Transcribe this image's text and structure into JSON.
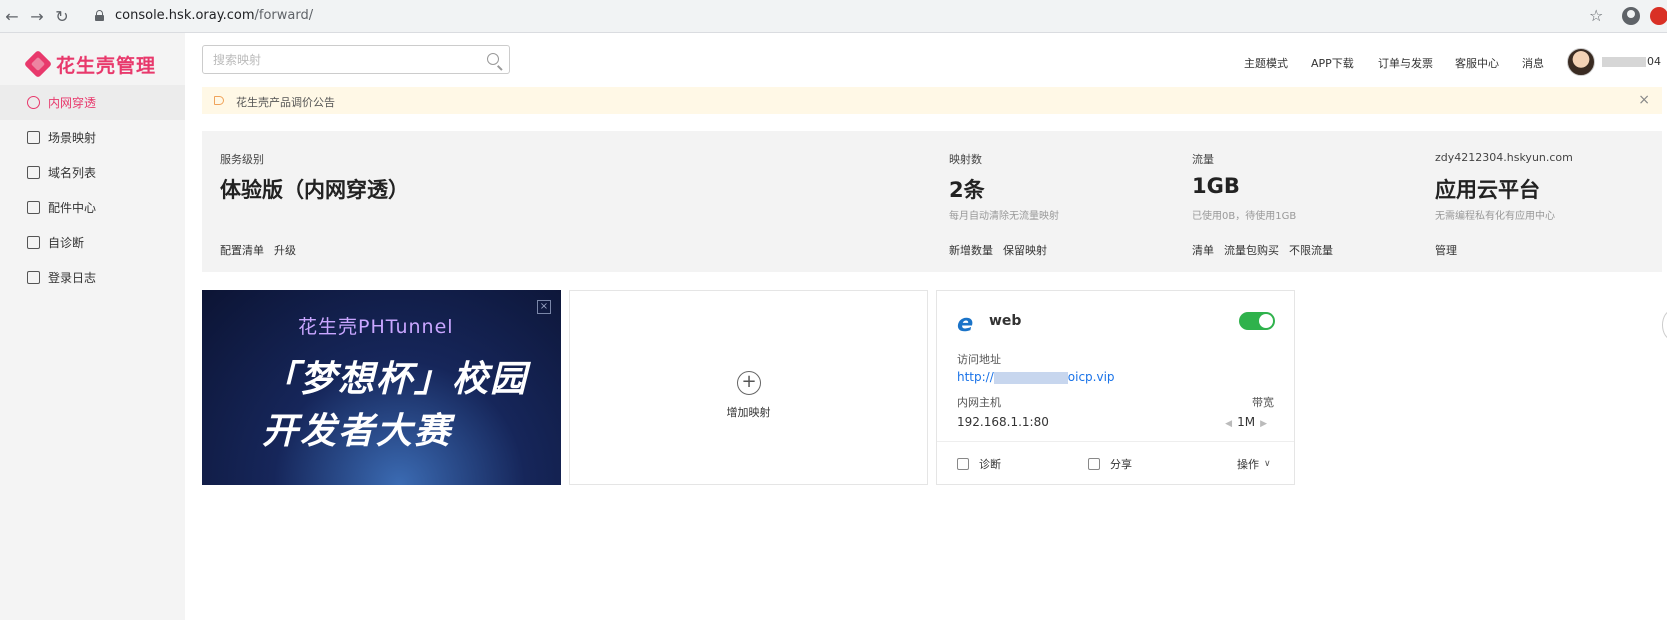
{
  "browser": {
    "url_host": "console.hsk.oray.com",
    "url_path": "/forward/"
  },
  "brand": {
    "name": "花生壳管理"
  },
  "sidebar": {
    "items": [
      {
        "label": "内网穿透",
        "icon": "network-icon",
        "active": true
      },
      {
        "label": "场景映射",
        "icon": "scene-icon",
        "active": false
      },
      {
        "label": "域名列表",
        "icon": "domain-icon",
        "active": false
      },
      {
        "label": "配件中心",
        "icon": "grid-icon",
        "active": false
      },
      {
        "label": "自诊断",
        "icon": "stethoscope-icon",
        "active": false
      },
      {
        "label": "登录日志",
        "icon": "log-icon",
        "active": false
      }
    ]
  },
  "header": {
    "search_placeholder": "搜索映射",
    "nav": [
      "主题模式",
      "APP下载",
      "订单与发票",
      "客服中心",
      "消息"
    ],
    "username_suffix": "04"
  },
  "notice": {
    "text": "花生壳产品调价公告"
  },
  "summary": {
    "service": {
      "label": "服务级别",
      "value": "体验版（内网穿透）",
      "links": [
        "配置清单",
        "升级"
      ]
    },
    "mappings": {
      "label": "映射数",
      "value": "2条",
      "sub": "每月自动清除无流量映射",
      "links": [
        "新增数量",
        "保留映射"
      ]
    },
    "traffic": {
      "label": "流量",
      "value": "1GB",
      "sub": "已使用0B，待使用1GB",
      "links": [
        "清单",
        "流量包购买",
        "不限流量"
      ]
    },
    "cloud": {
      "label": "zdy4212304.hskyun.com",
      "value": "应用云平台",
      "sub": "无需编程私有化有应用中心",
      "links": [
        "管理"
      ]
    }
  },
  "banner": {
    "line1": "花生壳PHTunnel",
    "line2": "「梦想杯」校园",
    "line3": "开发者大赛",
    "close": "×"
  },
  "add_card": {
    "label": "增加映射",
    "plus": "+"
  },
  "web_card": {
    "title": "web",
    "enabled": true,
    "addr_label": "访问地址",
    "addr_prefix": "http://",
    "addr_suffix": "oicp.vip",
    "host_label": "内网主机",
    "host_value": "192.168.1.1:80",
    "bw_label": "带宽",
    "bw_value": "1M",
    "footer": {
      "diagnose": "诊断",
      "share": "分享",
      "ops": "操作"
    }
  }
}
